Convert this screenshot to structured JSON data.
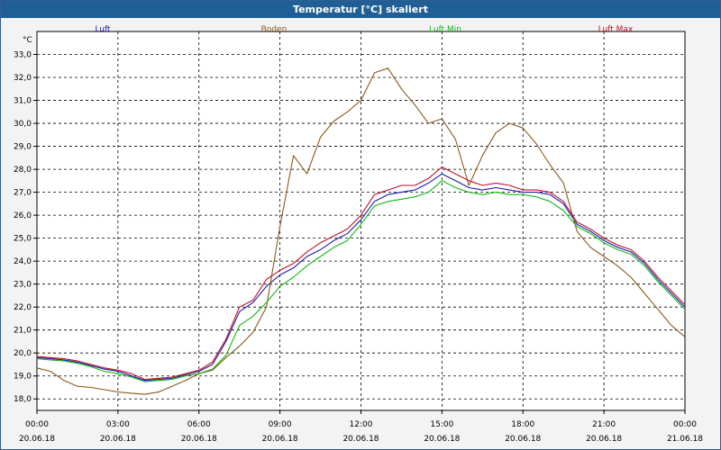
{
  "window": {
    "title": "Temperatur [°C] skaliert"
  },
  "chart_data": {
    "type": "line",
    "yunit": "°C",
    "ylim": [
      17.5,
      34.0
    ],
    "yticks": [
      18.0,
      19.0,
      20.0,
      21.0,
      22.0,
      23.0,
      24.0,
      25.0,
      26.0,
      27.0,
      28.0,
      29.0,
      30.0,
      31.0,
      32.0,
      33.0
    ],
    "ytick_labels": [
      "18,0",
      "19,0",
      "20,0",
      "21,0",
      "22,0",
      "23,0",
      "24,0",
      "25,0",
      "26,0",
      "27,0",
      "28,0",
      "29,0",
      "30,0",
      "31,0",
      "32,0",
      "33,0"
    ],
    "xlim": [
      0,
      24
    ],
    "xticks": [
      {
        "time": "00:00",
        "date": "20.06.18"
      },
      {
        "time": "03:00",
        "date": "20.06.18"
      },
      {
        "time": "06:00",
        "date": "20.06.18"
      },
      {
        "time": "09:00",
        "date": "20.06.18"
      },
      {
        "time": "12:00",
        "date": "20.06.18"
      },
      {
        "time": "15:00",
        "date": "20.06.18"
      },
      {
        "time": "18:00",
        "date": "20.06.18"
      },
      {
        "time": "21:00",
        "date": "20.06.18"
      },
      {
        "time": "00:00",
        "date": "21.06.18"
      }
    ],
    "grid": true,
    "legend_position": "top",
    "x_hours": [
      0,
      0.5,
      1,
      1.5,
      2,
      2.5,
      3,
      3.5,
      4,
      4.5,
      5,
      5.5,
      6,
      6.5,
      7,
      7.5,
      8,
      8.5,
      9,
      9.5,
      10,
      10.5,
      11,
      11.5,
      12,
      12.5,
      13,
      13.5,
      14,
      14.5,
      15,
      15.5,
      16,
      16.5,
      17,
      17.5,
      18,
      18.5,
      19,
      19.5,
      20,
      20.5,
      21,
      21.5,
      22,
      22.5,
      23,
      23.5,
      24
    ],
    "series": [
      {
        "name": "Luft",
        "color": "#1a1aa8",
        "values": [
          19.8,
          19.75,
          19.7,
          19.6,
          19.45,
          19.3,
          19.2,
          19.0,
          18.8,
          18.85,
          18.9,
          19.05,
          19.2,
          19.5,
          20.5,
          21.8,
          22.2,
          22.9,
          23.4,
          23.7,
          24.2,
          24.5,
          24.9,
          25.2,
          25.8,
          26.6,
          26.9,
          27.0,
          27.1,
          27.4,
          27.8,
          27.5,
          27.2,
          27.1,
          27.2,
          27.1,
          27.0,
          27.0,
          26.9,
          26.5,
          25.6,
          25.3,
          24.9,
          24.6,
          24.4,
          23.9,
          23.2,
          22.6,
          22.0
        ]
      },
      {
        "name": "Boden",
        "color": "#8a5a1c",
        "values": [
          19.35,
          19.2,
          18.8,
          18.55,
          18.5,
          18.4,
          18.3,
          18.25,
          18.2,
          18.3,
          18.55,
          18.8,
          19.1,
          19.25,
          19.8,
          20.3,
          20.9,
          22.0,
          25.5,
          28.6,
          27.8,
          29.4,
          30.1,
          30.5,
          31.0,
          32.2,
          32.4,
          31.5,
          30.8,
          30.0,
          30.2,
          29.3,
          27.3,
          28.6,
          29.6,
          30.0,
          29.8,
          29.1,
          28.2,
          27.4,
          25.3,
          24.6,
          24.2,
          23.8,
          23.3,
          22.6,
          21.9,
          21.2,
          20.7
        ]
      },
      {
        "name": "Luft Min",
        "color": "#14b814",
        "values": [
          19.75,
          19.7,
          19.65,
          19.55,
          19.4,
          19.2,
          19.1,
          18.95,
          18.75,
          18.8,
          18.85,
          19.0,
          19.1,
          19.3,
          19.9,
          21.2,
          21.6,
          22.2,
          22.9,
          23.3,
          23.8,
          24.2,
          24.6,
          24.9,
          25.6,
          26.4,
          26.6,
          26.7,
          26.8,
          27.0,
          27.5,
          27.2,
          27.0,
          26.9,
          27.0,
          26.9,
          26.9,
          26.8,
          26.6,
          26.2,
          25.5,
          25.2,
          24.8,
          24.5,
          24.3,
          23.8,
          23.1,
          22.5,
          21.9
        ]
      },
      {
        "name": "Luft Max",
        "color": "#c0102a",
        "values": [
          19.85,
          19.8,
          19.75,
          19.65,
          19.5,
          19.35,
          19.25,
          19.1,
          18.85,
          18.9,
          18.95,
          19.1,
          19.25,
          19.6,
          20.6,
          22.0,
          22.3,
          23.2,
          23.6,
          23.9,
          24.4,
          24.8,
          25.1,
          25.4,
          26.0,
          26.9,
          27.1,
          27.3,
          27.3,
          27.6,
          28.1,
          27.8,
          27.5,
          27.3,
          27.4,
          27.3,
          27.1,
          27.1,
          27.0,
          26.6,
          25.7,
          25.4,
          25.0,
          24.7,
          24.5,
          24.0,
          23.3,
          22.7,
          22.1
        ]
      }
    ]
  }
}
